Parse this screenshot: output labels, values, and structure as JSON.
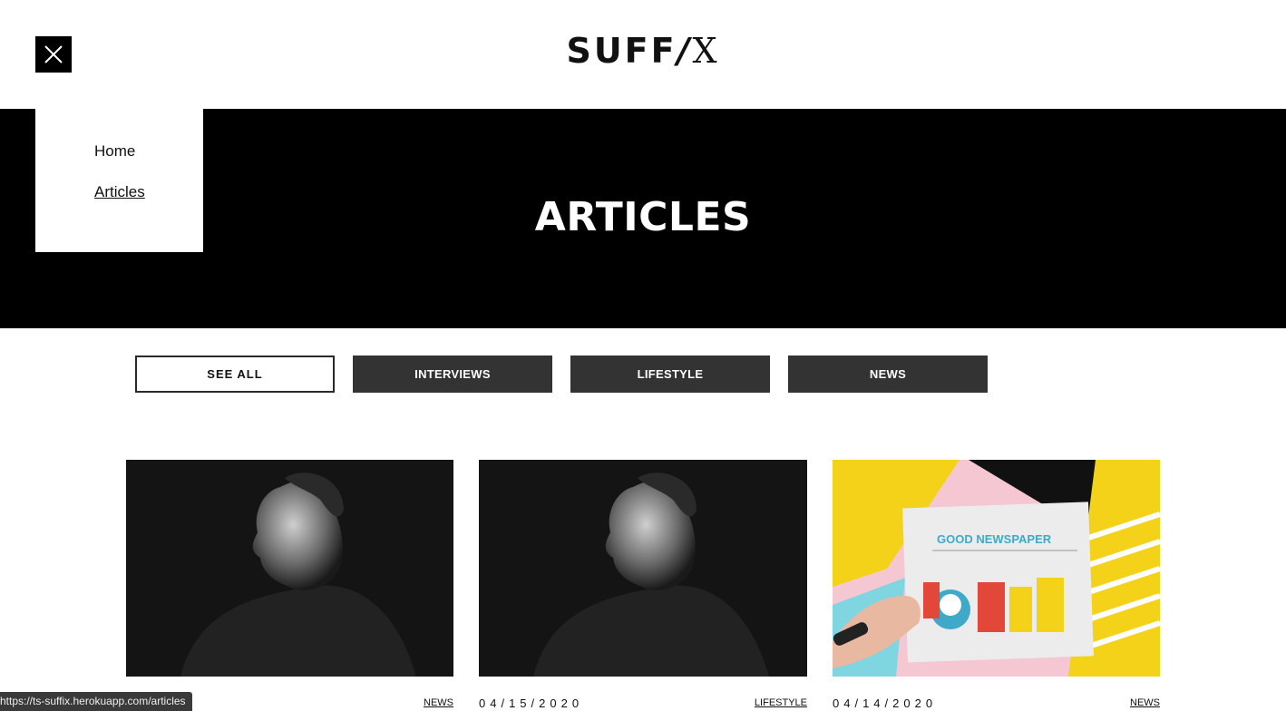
{
  "header": {
    "logo_main": "SUFF",
    "logo_slash": "/",
    "logo_end": "X"
  },
  "menu": {
    "items": [
      {
        "label": "Home",
        "active": false
      },
      {
        "label": "Articles",
        "active": true
      }
    ]
  },
  "hero": {
    "title": "ARTICLES"
  },
  "filters": [
    "SEE ALL",
    "INTERVIEWS",
    "LIFESTYLE",
    "NEWS"
  ],
  "cards": [
    {
      "date": "020",
      "tag": "NEWS",
      "image": "man-profile-portrait"
    },
    {
      "date": "04/15/2020",
      "tag": "LIFESTYLE",
      "image": "man-profile-portrait"
    },
    {
      "date": "04/14/2020",
      "tag": "NEWS",
      "image": "good-newspaper-hand"
    }
  ],
  "newspaper_headline": "GOOD NEWSPAPER",
  "status_bar": {
    "url": "https://ts-suffix.herokuapp.com/articles"
  },
  "colors": {
    "hero_bg": "#000000",
    "button_dark": "#333333",
    "accent_yellow": "#f5d21a"
  }
}
